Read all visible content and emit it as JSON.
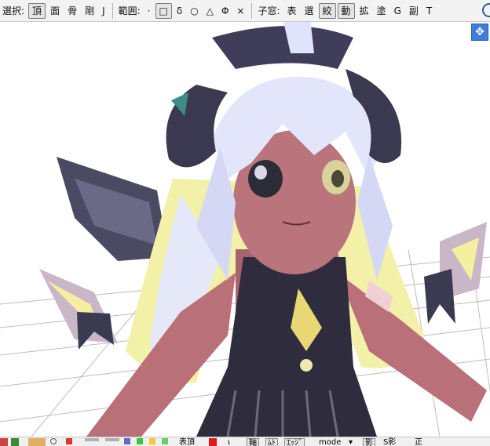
{
  "toolbar": {
    "select_label": "選択:",
    "select_buttons": [
      {
        "label": "頂",
        "active": true
      },
      {
        "label": "面",
        "active": false
      },
      {
        "label": "骨",
        "active": false
      },
      {
        "label": "剛",
        "active": false
      },
      {
        "label": "J",
        "active": false
      }
    ],
    "range_label": "範囲:",
    "range_buttons": [
      {
        "label": "·",
        "active": false
      },
      {
        "label": "□",
        "active": true
      },
      {
        "label": "δ",
        "active": false
      },
      {
        "label": "○",
        "active": false
      },
      {
        "label": "△",
        "active": false
      },
      {
        "label": "Φ",
        "active": false
      },
      {
        "label": "×",
        "active": false
      }
    ],
    "subwindow_label": "子窓:",
    "subwindow_buttons": [
      {
        "label": "表",
        "active": false
      },
      {
        "label": "選",
        "active": false
      },
      {
        "label": "絞",
        "active": true
      },
      {
        "label": "動",
        "active": true
      },
      {
        "label": "拡",
        "active": false
      },
      {
        "label": "塗",
        "active": false
      },
      {
        "label": "G",
        "active": false
      },
      {
        "label": "副",
        "active": false
      },
      {
        "label": "T",
        "active": false
      }
    ]
  },
  "view_gizmo": {
    "icon": "move-arrows-icon"
  },
  "bottombar": {
    "expression_label": "表頂",
    "shi_label": "ι",
    "axis_label": "軸",
    "moku_label": "ﾑﾄ",
    "edge_label": "ｴｯｼﾞ",
    "mode_label": "mode",
    "mode_arrow": "▾",
    "shadow_label": "影",
    "sshadow_label": "S影",
    "sei_label": "正"
  },
  "colors": {
    "toolbar_bg": "#f3f3f3",
    "viewport_bg": "#ffffff",
    "grid_line": "#bdbdbd",
    "gizmo": "#3d7fd8"
  }
}
